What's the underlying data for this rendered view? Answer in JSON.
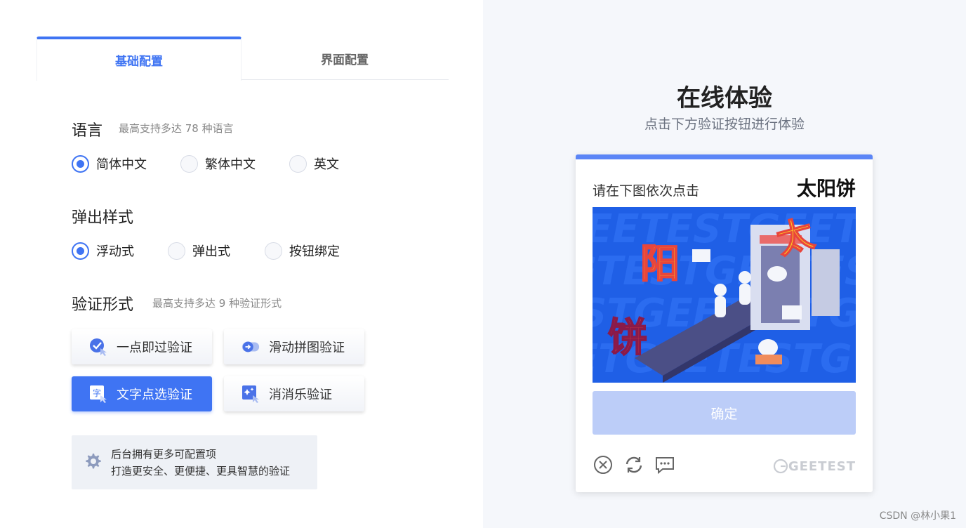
{
  "tabs": [
    {
      "label": "基础配置",
      "active": true
    },
    {
      "label": "界面配置",
      "active": false
    }
  ],
  "language": {
    "title": "语言",
    "hint": "最高支持多达 78 种语言",
    "options": [
      {
        "label": "简体中文",
        "checked": true
      },
      {
        "label": "繁体中文",
        "checked": false
      },
      {
        "label": "英文",
        "checked": false
      }
    ]
  },
  "popup": {
    "title": "弹出样式",
    "options": [
      {
        "label": "浮动式",
        "checked": true
      },
      {
        "label": "弹出式",
        "checked": false
      },
      {
        "label": "按钮绑定",
        "checked": false
      }
    ]
  },
  "verify": {
    "title": "验证形式",
    "hint": "最高支持多达 9 种验证形式",
    "buttons": [
      {
        "label": "一点即过验证",
        "icon": "check-click-icon",
        "active": false
      },
      {
        "label": "滑动拼图验证",
        "icon": "slider-icon",
        "active": false
      },
      {
        "label": "文字点选验证",
        "icon": "text-select-icon",
        "active": true
      },
      {
        "label": "消消乐验证",
        "icon": "match-icon",
        "active": false
      }
    ]
  },
  "info": {
    "line1": "后台拥有更多可配置项",
    "line2": "打造更安全、更便捷、更具智慧的验证",
    "icon": "gear-icon"
  },
  "demo": {
    "title": "在线体验",
    "subtitle": "点击下方验证按钮进行体验"
  },
  "captcha": {
    "prompt": "请在下图依次点击",
    "target": "太阳饼",
    "image_chars": [
      "阳",
      "饼",
      "太"
    ],
    "confirm_label": "确定",
    "brand": "GEETEST",
    "accent": "#5b85f6",
    "icons": [
      "close-icon",
      "refresh-icon",
      "feedback-icon"
    ]
  },
  "watermark": "CSDN @林小果1",
  "colors": {
    "primary": "#3f74f3",
    "confirm_disabled": "#bccdf8",
    "right_bg": "#f5f7fb"
  }
}
